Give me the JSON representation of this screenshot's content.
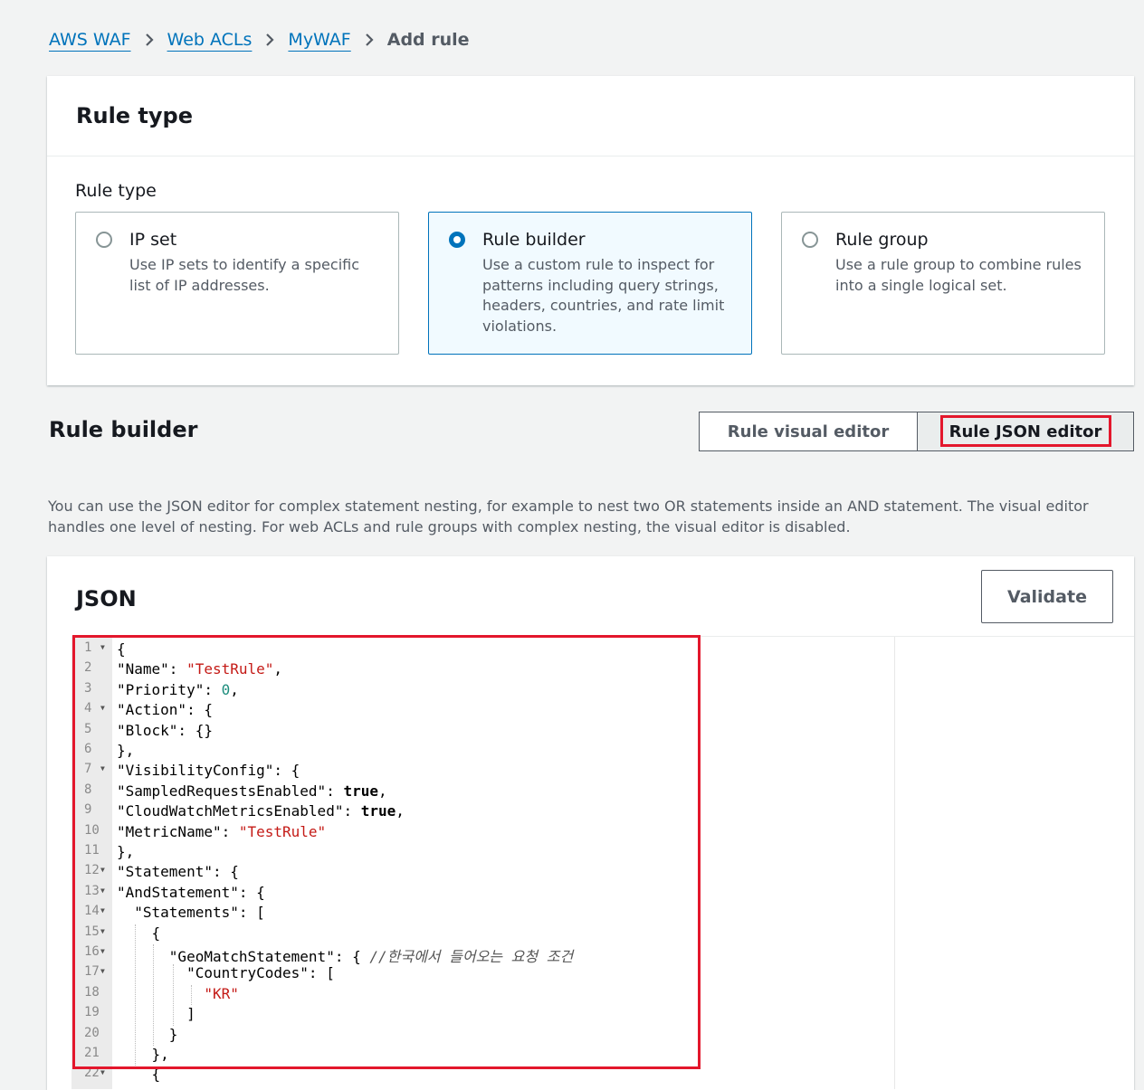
{
  "breadcrumb": {
    "items": [
      "AWS WAF",
      "Web ACLs",
      "MyWAF"
    ],
    "current": "Add rule"
  },
  "rule_type_panel": {
    "title": "Rule type",
    "field_label": "Rule type",
    "options": [
      {
        "title": "IP set",
        "description": "Use IP sets to identify a specific list of IP addresses.",
        "selected": false
      },
      {
        "title": "Rule builder",
        "description": "Use a custom rule to inspect for patterns including query strings, headers, countries, and rate limit violations.",
        "selected": true
      },
      {
        "title": "Rule group",
        "description": "Use a rule group to combine rules into a single logical set.",
        "selected": false
      }
    ]
  },
  "rule_builder": {
    "title": "Rule builder",
    "visual_editor_label": "Rule visual editor",
    "json_editor_label": "Rule JSON editor",
    "selected_editor": "Rule JSON editor",
    "description": "You can use the JSON editor for complex statement nesting, for example to nest two OR statements inside an AND statement. The visual editor handles one level of nesting. For web ACLs and rule groups with complex nesting, the visual editor is disabled."
  },
  "json_panel": {
    "title": "JSON",
    "validate_label": "Validate",
    "lines": [
      {
        "n": "1",
        "fold": true,
        "text": "{"
      },
      {
        "n": "2",
        "fold": false,
        "text": "\"Name\": \"TestRule\","
      },
      {
        "n": "3",
        "fold": false,
        "text": "\"Priority\": 0,"
      },
      {
        "n": "4",
        "fold": true,
        "text": "\"Action\": {"
      },
      {
        "n": "5",
        "fold": false,
        "text": "\"Block\": {}"
      },
      {
        "n": "6",
        "fold": false,
        "text": "},"
      },
      {
        "n": "7",
        "fold": true,
        "text": "\"VisibilityConfig\": {"
      },
      {
        "n": "8",
        "fold": false,
        "text": "\"SampledRequestsEnabled\": true,"
      },
      {
        "n": "9",
        "fold": false,
        "text": "\"CloudWatchMetricsEnabled\": true,"
      },
      {
        "n": "10",
        "fold": false,
        "text": "\"MetricName\": \"TestRule\""
      },
      {
        "n": "11",
        "fold": false,
        "text": "},"
      },
      {
        "n": "12",
        "fold": true,
        "text": "\"Statement\": {"
      },
      {
        "n": "13",
        "fold": true,
        "text": "\"AndStatement\": {"
      },
      {
        "n": "14",
        "fold": true,
        "text": "  \"Statements\": ["
      },
      {
        "n": "15",
        "fold": true,
        "text": "    {"
      },
      {
        "n": "16",
        "fold": true,
        "text": "      \"GeoMatchStatement\": { //한국에서 들어오는 요청 조건"
      },
      {
        "n": "17",
        "fold": true,
        "text": "        \"CountryCodes\": ["
      },
      {
        "n": "18",
        "fold": false,
        "text": "          \"KR\""
      },
      {
        "n": "19",
        "fold": false,
        "text": "        ]"
      },
      {
        "n": "20",
        "fold": false,
        "text": "      }"
      },
      {
        "n": "21",
        "fold": false,
        "text": "    },"
      },
      {
        "n": "22",
        "fold": true,
        "text": "    {"
      }
    ]
  },
  "colors": {
    "link": "#0073bb",
    "highlight": "#e3172c",
    "string": "#c41a16",
    "number": "#1c8c7c"
  }
}
